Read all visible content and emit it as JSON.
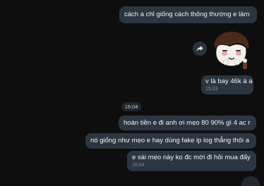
{
  "messages": [
    {
      "id": "m1",
      "text": "cách a chỉ giống cách thông thường e làm",
      "time": ""
    },
    {
      "id": "m2",
      "text": "v là bay 46k à a",
      "time": "15:23"
    },
    {
      "id": "m3",
      "text": "hoàn tiền e đi anh ơi mẹo 80 90% gì 4 ac r",
      "time": ""
    },
    {
      "id": "m4",
      "text": "nó giống như mẹo e hay dùng fake ip log thẳng thôi a",
      "time": ""
    },
    {
      "id": "m5",
      "text": "e sài mẹo này ko đc mới đi hỏi mua đấy",
      "time": "16:04"
    }
  ],
  "date_separator": "16:04",
  "sticker": {
    "description": "cartoon-character-sticker"
  },
  "icons": {
    "forward": "share-forward-icon",
    "scroll": "scroll-down-button"
  },
  "colors": {
    "background": "#0e0e0e",
    "bubble": "#2b3640",
    "time_text": "#7d8b97"
  }
}
